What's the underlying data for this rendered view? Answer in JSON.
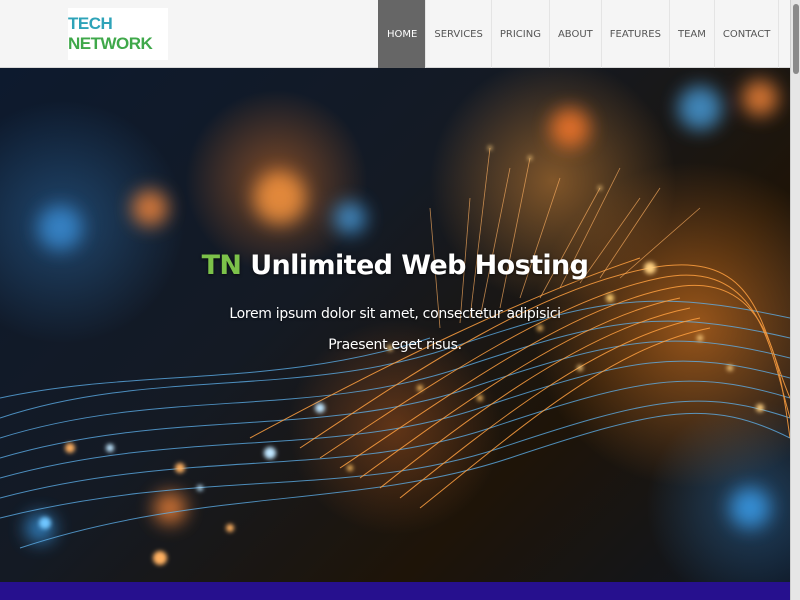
{
  "logo": {
    "part1": "TECH ",
    "part2": "NETWORK",
    "colors": {
      "tech": "#2ea3b8",
      "network": "#3fa84a"
    }
  },
  "nav": {
    "items": [
      {
        "label": "HOME",
        "active": true
      },
      {
        "label": "SERVICES",
        "active": false
      },
      {
        "label": "PRICING",
        "active": false
      },
      {
        "label": "ABOUT",
        "active": false
      },
      {
        "label": "FEATURES",
        "active": false
      },
      {
        "label": "TEAM",
        "active": false
      },
      {
        "label": "CONTACT",
        "active": false
      }
    ],
    "active_color": "#666666"
  },
  "hero": {
    "title_accent": "TN",
    "title_rest": " Unlimited Web Hosting",
    "subtitle_line1": "Lorem ipsum dolor sit amet, consectetur adipisici",
    "subtitle_line2": "Praesent eget risus.",
    "accent_color": "#7cc24a",
    "background_image": "glowing fiber optic cables"
  },
  "bottom_band_color": "#26108e"
}
